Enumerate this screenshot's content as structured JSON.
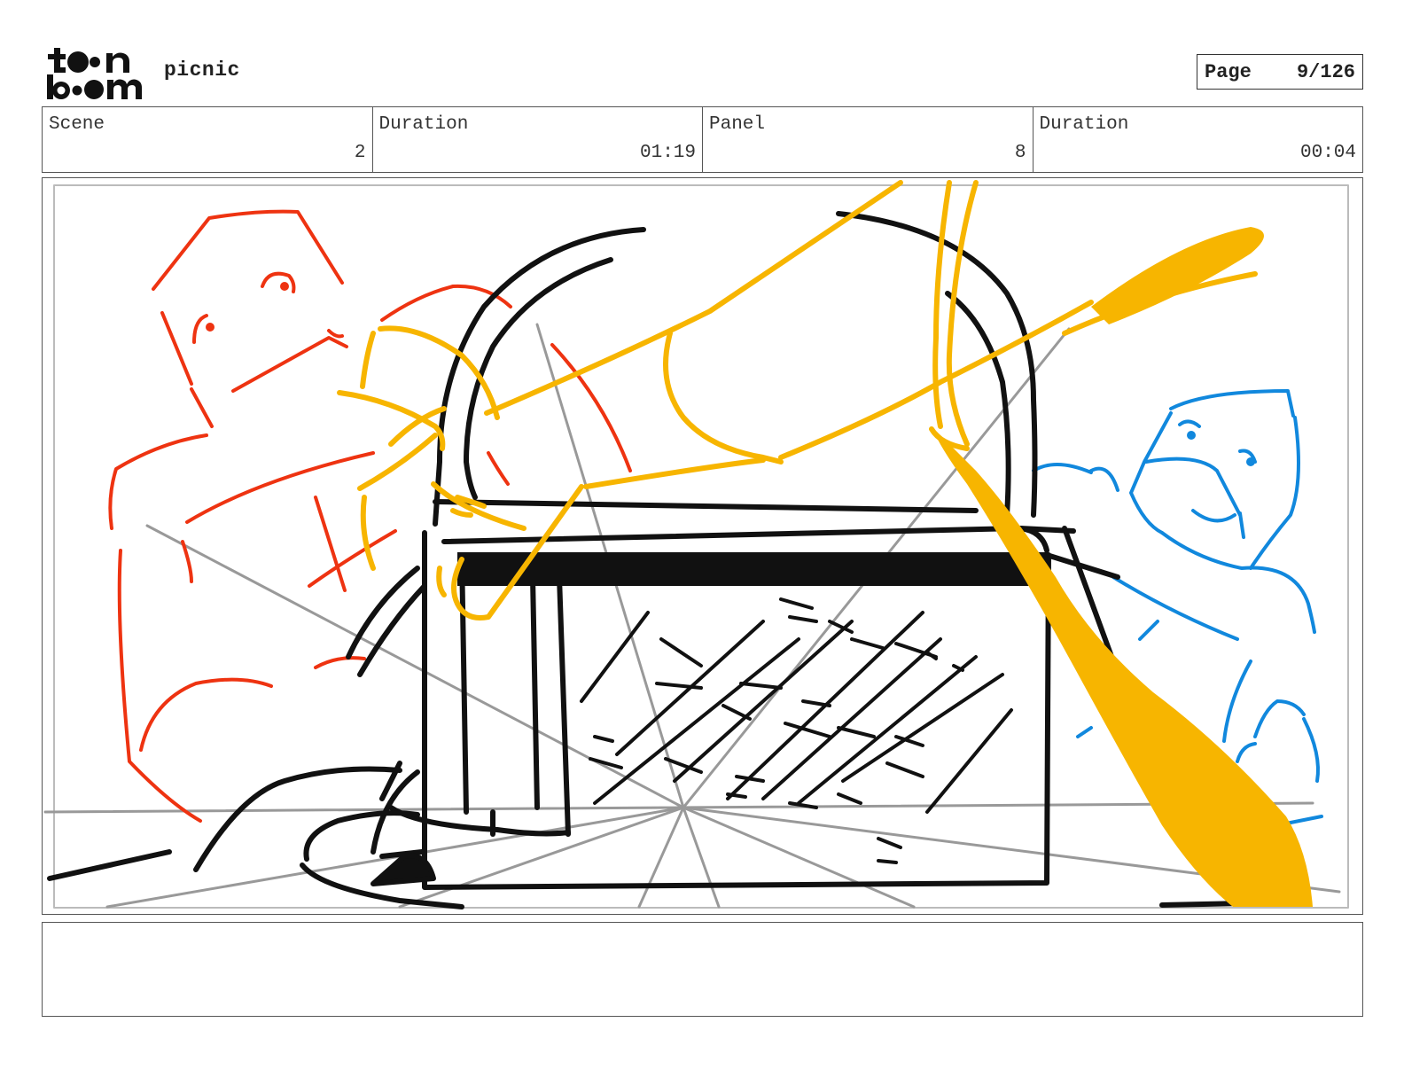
{
  "header": {
    "logo_text": "toonboom",
    "project_title": "picnic",
    "page_label": "Page",
    "page_value": "9/126"
  },
  "info": {
    "scene": {
      "label": "Scene",
      "value": "2"
    },
    "scene_duration": {
      "label": "Duration",
      "value": "01:19"
    },
    "panel": {
      "label": "Panel",
      "value": "8"
    },
    "panel_duration": {
      "label": "Duration",
      "value": "00:04"
    }
  },
  "colors": {
    "red": "#ee3311",
    "blue": "#1188dd",
    "yellow": "#f7b500",
    "ink": "#111111",
    "guide": "#999999"
  },
  "notes": {
    "text": ""
  }
}
